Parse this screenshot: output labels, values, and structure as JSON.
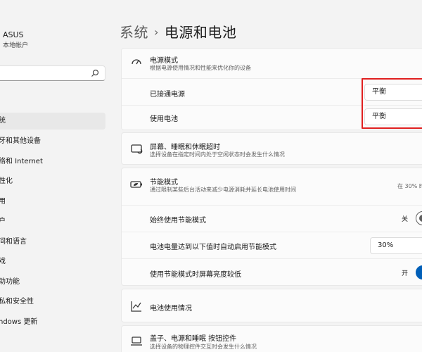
{
  "account": {
    "name": "ASUS",
    "type": "本地帐户"
  },
  "search": {
    "placeholder": ""
  },
  "sidebar": {
    "items": [
      {
        "label": ""
      },
      {
        "label": "统"
      },
      {
        "label": "牙和其他设备"
      },
      {
        "label": "络和 Internet"
      },
      {
        "label": "性化"
      },
      {
        "label": "用"
      },
      {
        "label": "户"
      },
      {
        "label": "间和语言"
      },
      {
        "label": "戏"
      },
      {
        "label": "助功能"
      },
      {
        "label": "私和安全性"
      },
      {
        "label": "ndows 更新"
      }
    ],
    "active_index": 1
  },
  "header": {
    "parent": "系统",
    "title": "电源和电池"
  },
  "power_mode": {
    "title": "电源模式",
    "desc": "根据电源使用情况和性能来优化你的设备",
    "plugged_label": "已接通电源",
    "plugged_value": "平衡",
    "battery_label": "使用电池",
    "battery_value": "平衡"
  },
  "screen_sleep": {
    "title": "屏幕、睡眠和休眠超时",
    "desc": "选择设备在指定时间内处于空闲状态时会发生什么情况"
  },
  "energy_saver": {
    "title": "节能模式",
    "desc": "通过限制某些后台活动来减少电源消耗并延长电池使用时间",
    "status": "在 30% 时",
    "always_label": "始终使用节能模式",
    "always_state": "关",
    "auto_label": "电池电量达到以下值时自动启用节能模式",
    "auto_value": "30%",
    "brightness_label": "使用节能模式时屏幕亮度较低",
    "brightness_state": "开"
  },
  "battery_usage": {
    "title": "电池使用情况"
  },
  "lid_buttons": {
    "title": "盖子、电源和睡眠 按钮控件",
    "desc": "选择设备的物理控件交互时会发生什么情况"
  },
  "colors": {
    "accent": "#005fb8",
    "highlight": "#e02020"
  }
}
